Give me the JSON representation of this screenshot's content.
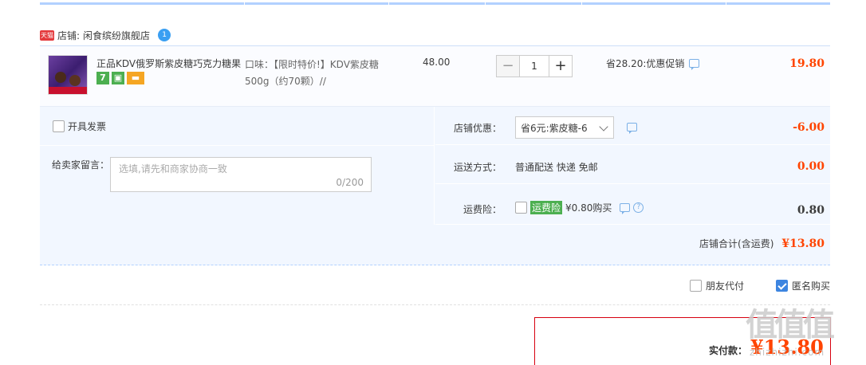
{
  "shop": {
    "badge": "天猫",
    "label": "店铺:",
    "name": "闲食缤纷旗舰店",
    "ww_badge": "1"
  },
  "item": {
    "title": "正品KDV俄罗斯紫皮糖巧克力糖果",
    "service_icons": [
      "7",
      "▣",
      "▬"
    ],
    "sku": "口味：【限时特价!】KDV紫皮糖500g（约70颗）//",
    "price": "48.00",
    "quantity": "1",
    "qty_minus": "−",
    "qty_plus": "+",
    "promo": "省28.20:优惠促销",
    "subtotal": "19.80"
  },
  "options": {
    "invoice_label": "开具发票",
    "message_label": "给卖家留言：",
    "message_placeholder": "选填,请先和商家协商一致",
    "message_count": "0/200",
    "shop_discount": {
      "label": "店铺优惠：",
      "selected": "省6元:紫皮糖-6",
      "amount": "-6.00"
    },
    "shipping": {
      "label": "运送方式：",
      "value": "普通配送 快递 免邮",
      "amount": "0.00"
    },
    "insurance": {
      "label": "运费险：",
      "tag": "运费险",
      "value": "¥0.80购买",
      "qmark": "?",
      "amount": "0.80"
    },
    "shop_total": {
      "label": "店铺合计(含运费)",
      "amount": "¥13.80"
    }
  },
  "extras": {
    "friend_pay": {
      "label": "朋友代付",
      "checked": false
    },
    "anonymous": {
      "label": "匿名购买",
      "checked": true
    }
  },
  "payment": {
    "label": "实付款：",
    "amount": "¥13.80"
  },
  "watermark": {
    "text": "值值值",
    "sub": "zhizhizhi.com"
  },
  "colors": {
    "accent": "#ff4400",
    "border_blue": "#b2d1ff",
    "bg_blue": "#f2f7ff",
    "check_blue": "#3d85e0"
  }
}
